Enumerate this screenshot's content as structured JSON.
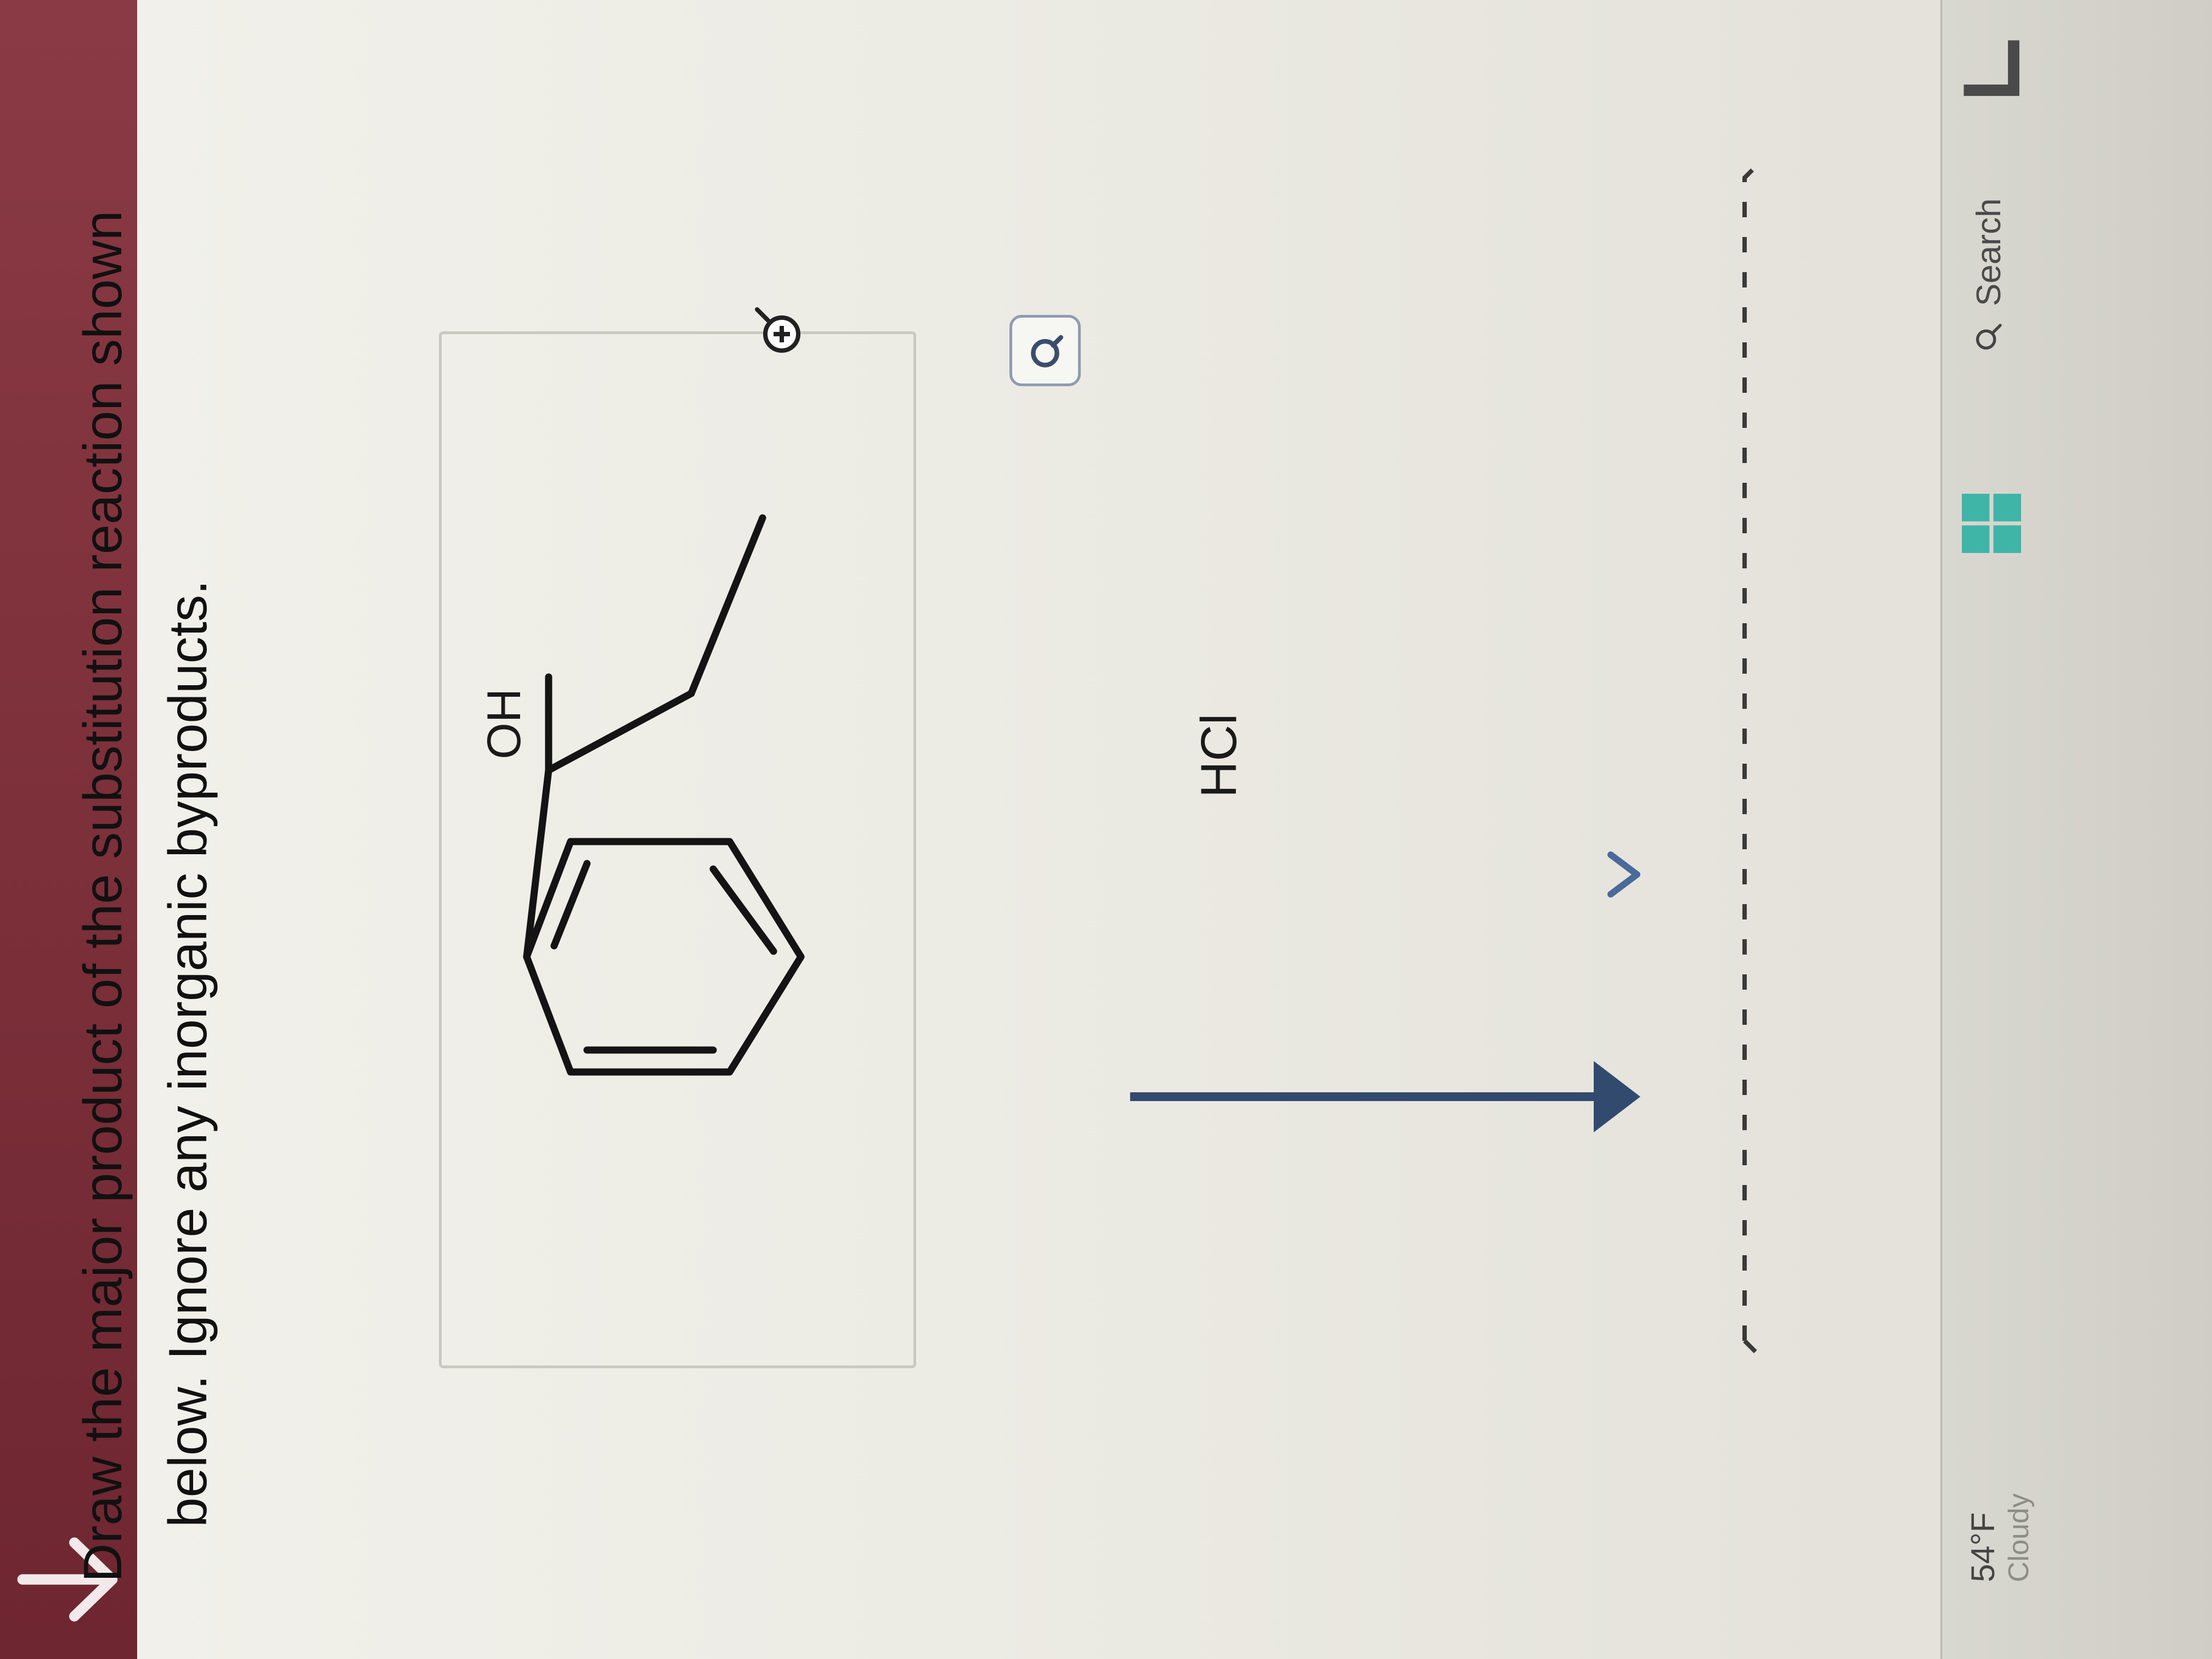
{
  "question": {
    "line1": "Draw the major product of the substitution reaction shown",
    "line2": "below. Ignore any inorganic byproducts."
  },
  "reaction": {
    "reactant_group_label": "OH",
    "reagent": "HCl"
  },
  "taskbar": {
    "weather_temp": "54°F",
    "weather_desc": "Cloudy",
    "search_label": "Search"
  },
  "colors": {
    "header_red": "#7a2e38",
    "arrow_navy": "#324a6e",
    "windows_teal": "#3fb5a8"
  }
}
